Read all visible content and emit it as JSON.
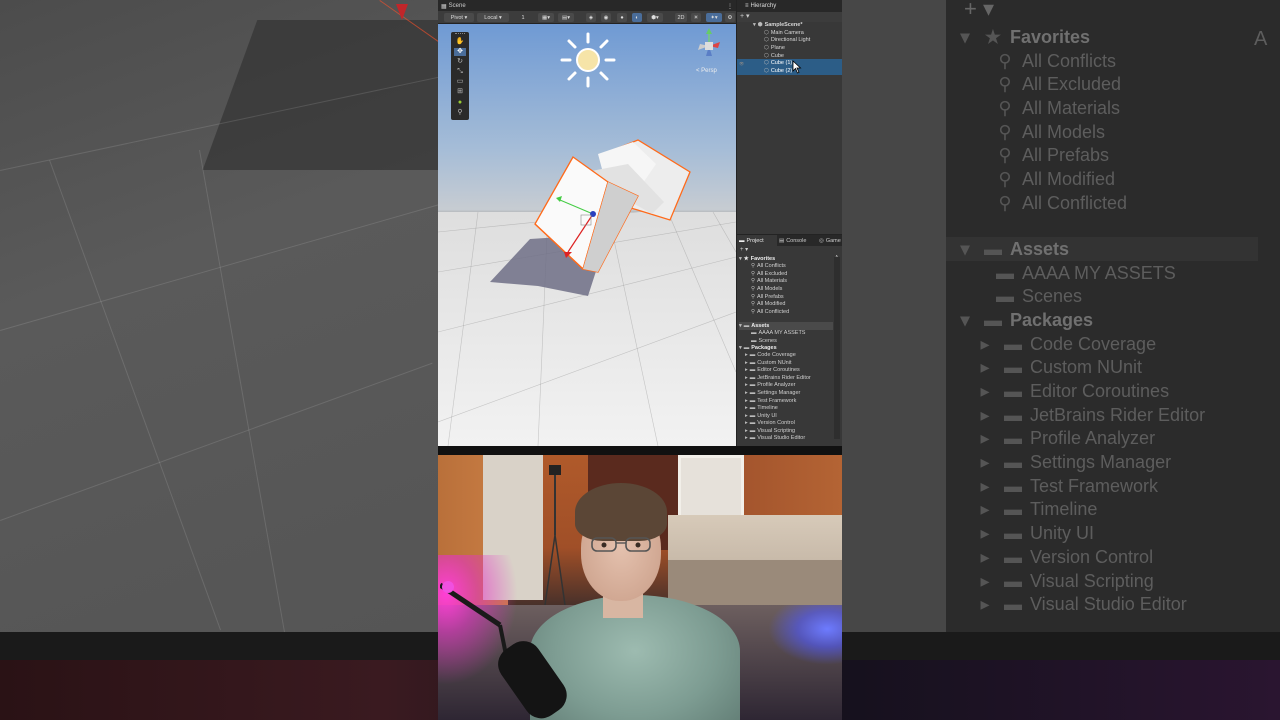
{
  "scene": {
    "tab_label": "Scene",
    "pivot_label": "Pivot",
    "local_label": "Local",
    "snap_value": "1",
    "mode_2d": "2D",
    "persp_label": "< Persp"
  },
  "hierarchy": {
    "tab_label": "Hierarchy",
    "add_label": "+ ▾",
    "scene_name": "SampleScene*",
    "items": [
      {
        "label": "Main Camera"
      },
      {
        "label": "Directional Light"
      },
      {
        "label": "Plane"
      },
      {
        "label": "Cube"
      },
      {
        "label": "Cube (1)"
      },
      {
        "label": "Cube (2)"
      }
    ]
  },
  "project": {
    "tabs": [
      "Project",
      "Console",
      "Game"
    ],
    "add_label": "+ ▾",
    "favorites_label": "Favorites",
    "favorites": [
      "All Conflicts",
      "All Excluded",
      "All Materials",
      "All Models",
      "All Prefabs",
      "All Modified",
      "All Conflicted"
    ],
    "assets_label": "Assets",
    "assets": [
      "AAAA MY ASSETS",
      "Scenes"
    ],
    "packages_label": "Packages",
    "packages": [
      "Code Coverage",
      "Custom NUnit",
      "Editor Coroutines",
      "JetBrains Rider Editor",
      "Profile Analyzer",
      "Settings Manager",
      "Test Framework",
      "Timeline",
      "Unity UI",
      "Version Control",
      "Visual Scripting",
      "Visual Studio Editor"
    ],
    "right_panel_label": "A"
  },
  "background_panel": {
    "favorites_label": "Favorites",
    "assets_label": "Assets",
    "packages_label": "Packages",
    "top_right_label": "A"
  },
  "colors": {
    "selection": "#2c5d87",
    "outline": "#ff6a1a",
    "editor_bg": "#383838"
  }
}
